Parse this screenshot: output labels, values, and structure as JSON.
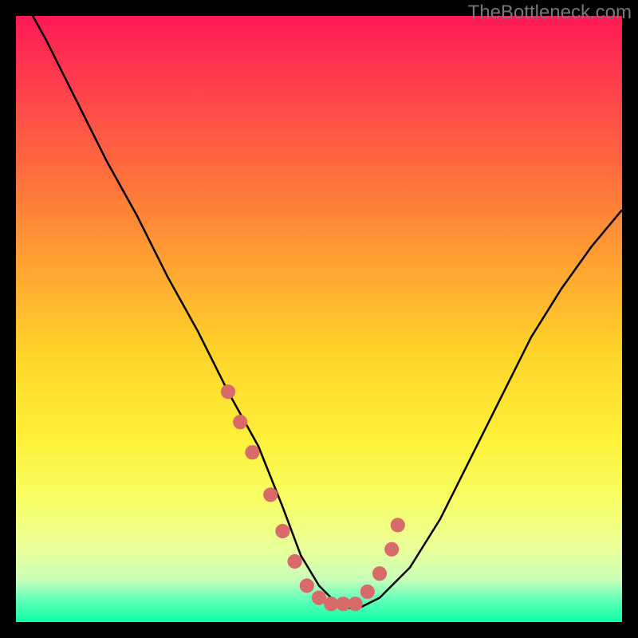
{
  "watermark": "TheBottleneck.com",
  "chart_data": {
    "type": "line",
    "title": "",
    "xlabel": "",
    "ylabel": "",
    "xlim": [
      0,
      100
    ],
    "ylim": [
      0,
      100
    ],
    "series": [
      {
        "name": "bottleneck-curve",
        "x": [
          0,
          5,
          10,
          15,
          20,
          25,
          30,
          35,
          40,
          44,
          47,
          50,
          53,
          56,
          60,
          65,
          70,
          75,
          80,
          85,
          90,
          95,
          100
        ],
        "values": [
          105,
          96,
          86,
          76,
          67,
          57,
          48,
          38,
          29,
          19,
          11,
          6,
          3,
          2,
          4,
          9,
          17,
          27,
          37,
          47,
          55,
          62,
          68
        ]
      }
    ],
    "markers": {
      "name": "highlight-points",
      "color": "#d86a6a",
      "radius": 1.2,
      "x": [
        35,
        37,
        39,
        42,
        44,
        46,
        48,
        50,
        52,
        54,
        56,
        58,
        60,
        62,
        63
      ],
      "values": [
        38,
        33,
        28,
        21,
        15,
        10,
        6,
        4,
        3,
        3,
        3,
        5,
        8,
        12,
        16
      ]
    }
  }
}
